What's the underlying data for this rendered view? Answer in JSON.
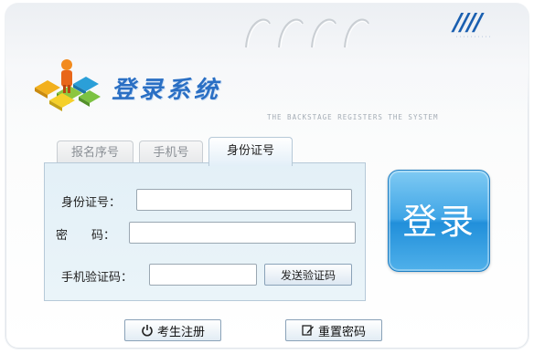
{
  "header": {
    "title": "登录系统",
    "subtitle": "THE BACKSTAGE REGISTERS THE SYSTEM",
    "corner_mark": "////"
  },
  "tabs": [
    {
      "label": "报名序号",
      "active": false
    },
    {
      "label": "手机号",
      "active": false
    },
    {
      "label": "身份证号",
      "active": true
    }
  ],
  "form": {
    "id_label": "身份证号：",
    "id_value": "",
    "password_label": "密　　码：",
    "password_value": "",
    "sms_label": "手机验证码：",
    "sms_value": "",
    "send_code_label": "发送验证码"
  },
  "login_label": "登录",
  "footer": {
    "register_label": "考生注册",
    "register_icon": "power-icon",
    "reset_label": "重置密码",
    "reset_icon": "edit-icon"
  },
  "colors": {
    "accent": "#2a6fc4",
    "login_button": "#3fa5e6",
    "panel": "#e3f0f7"
  }
}
